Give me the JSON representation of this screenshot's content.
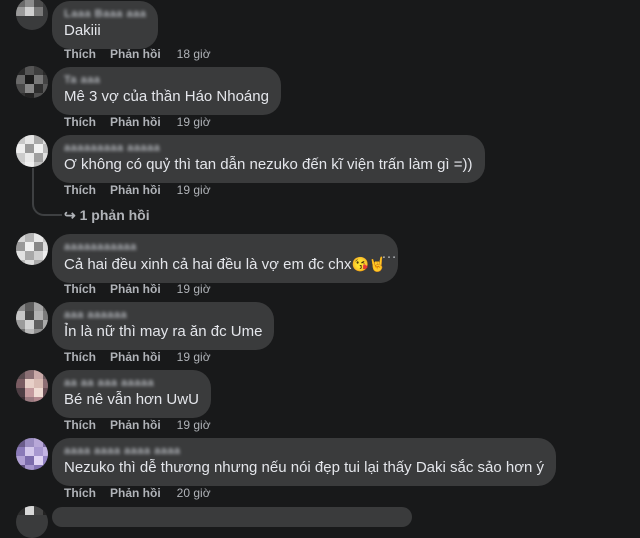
{
  "labels": {
    "like": "Thích",
    "reply": "Phản hồi"
  },
  "comments": [
    {
      "name": "Laaa Baaa aaa",
      "text": "Dakiii",
      "time": "18 giờ"
    },
    {
      "name": "Ta aaa",
      "text": "Mê 3 vợ của thần Háo Nhoáng",
      "time": "19 giờ"
    },
    {
      "name": "aaaaaaaaa aaaaa",
      "text": "Ơ không có quỷ thì tan dẫn nezuko đến kĩ viện trấn làm gì =))",
      "time": "19 giờ",
      "replies": "1 phản hồi"
    },
    {
      "name": "aaaaaaaaaaa",
      "text": "Cả hai đều xinh cả hai đều là vợ em đc chx",
      "emojis": "😘🤘",
      "time": "19 giờ"
    },
    {
      "name": "aaa aaaaaa",
      "text": "Ỉn là nữ thì may ra ăn đc Ume",
      "time": "19 giờ"
    },
    {
      "name": "aa aa aaa aaaaa",
      "text": "Bé nê vẫn hơn UwU",
      "time": "19 giờ"
    },
    {
      "name": "aaaa aaaa aaaa aaaa",
      "text": "Nezuko thì dễ thương nhưng nếu nói đẹp tui lại thấy Daki sắc sảo hơn ý",
      "time": "20 giờ"
    }
  ],
  "more_icon": "…",
  "colors": {
    "background": "#18191a",
    "bubble": "#3a3b3c",
    "secondary_text": "#b0b3b8",
    "primary_text": "#e4e6eb"
  }
}
